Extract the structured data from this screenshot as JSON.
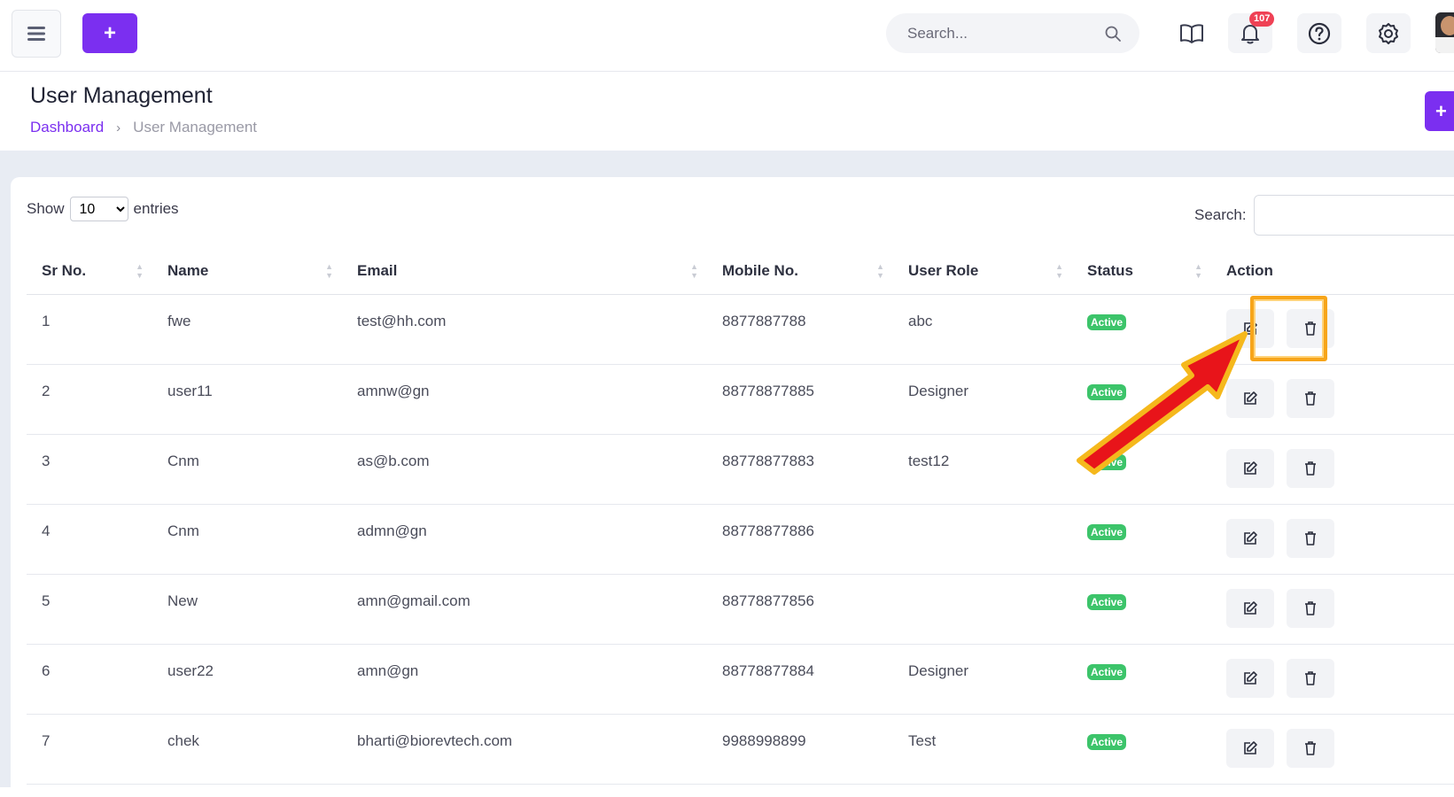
{
  "topbar": {
    "search_placeholder": "Search...",
    "notification_count": "107",
    "icons": [
      "menu-icon",
      "plus-icon",
      "search-icon",
      "book-icon",
      "bell-icon",
      "help-icon",
      "gear-icon"
    ]
  },
  "header": {
    "title": "User Management",
    "breadcrumb": {
      "home": "Dashboard",
      "separator": "›",
      "current": "User Management"
    },
    "add_label": "+"
  },
  "controls": {
    "show_label": "Show",
    "entries_value": "10",
    "entries_label": "entries",
    "search_label": "Search:"
  },
  "table": {
    "columns": [
      "Sr No.",
      "Name",
      "Email",
      "Mobile No.",
      "User Role",
      "Status",
      "Action"
    ],
    "rows": [
      {
        "sr": "1",
        "name": "fwe",
        "email": "test@hh.com",
        "mobile": "8877887788",
        "role": "abc",
        "status": "Active"
      },
      {
        "sr": "2",
        "name": "user11",
        "email": "amnw@gn",
        "mobile": "88778877885",
        "role": "Designer",
        "status": "Active"
      },
      {
        "sr": "3",
        "name": "Cnm",
        "email": "as@b.com",
        "mobile": "88778877883",
        "role": "test12",
        "status": "Active"
      },
      {
        "sr": "4",
        "name": "Cnm",
        "email": "admn@gn",
        "mobile": "88778877886",
        "role": "",
        "status": "Active"
      },
      {
        "sr": "5",
        "name": "New",
        "email": "amn@gmail.com",
        "mobile": "88778877856",
        "role": "",
        "status": "Active"
      },
      {
        "sr": "6",
        "name": "user22",
        "email": "amn@gn",
        "mobile": "88778877884",
        "role": "Designer",
        "status": "Active"
      },
      {
        "sr": "7",
        "name": "chek",
        "email": "bharti@biorevtech.com",
        "mobile": "9988998899",
        "role": "Test",
        "status": "Active"
      }
    ]
  },
  "colors": {
    "accent": "#7b2ff0",
    "status_active": "#3cc46a",
    "badge": "#ef4155",
    "highlight": "#f7a51a",
    "arrow": "#e8141a"
  }
}
